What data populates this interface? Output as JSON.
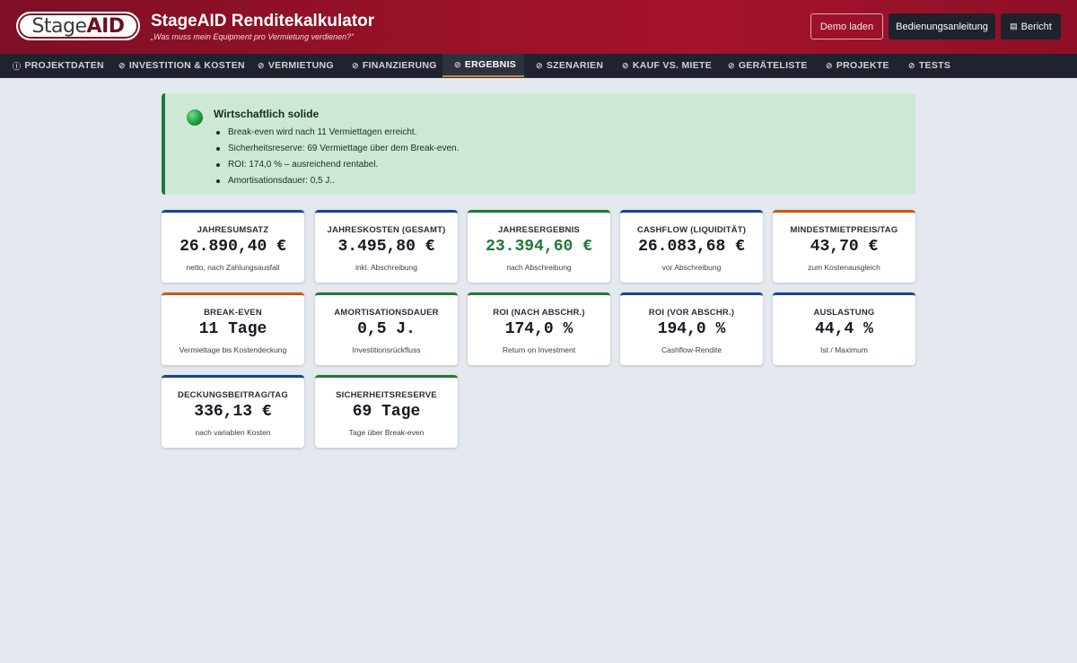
{
  "header": {
    "logo_stage": "Stage",
    "logo_aid": "AID",
    "title": "StageAID Renditekalkulator",
    "subtitle": "„Was muss mein Equipment pro Vermietung verdienen?“",
    "btn_demo": "Demo laden",
    "btn_manual": "Bedienungsanleitung",
    "btn_report": "Bericht"
  },
  "nav": [
    {
      "label": "PROJEKTDATEN",
      "icon": "info-icon"
    },
    {
      "label": "INVESTITION & KOSTEN",
      "icon": "circle-icon"
    },
    {
      "label": "VERMIETUNG",
      "icon": "circle-icon"
    },
    {
      "label": "FINANZIERUNG",
      "icon": "circle-icon"
    },
    {
      "label": "ERGEBNIS",
      "icon": "circle-icon"
    },
    {
      "label": "SZENARIEN",
      "icon": "circle-icon"
    },
    {
      "label": "KAUF VS. MIETE",
      "icon": "circle-icon"
    },
    {
      "label": "GERÄTELISTE",
      "icon": "circle-icon"
    },
    {
      "label": "PROJEKTE",
      "icon": "circle-icon"
    },
    {
      "label": "TESTS",
      "icon": "circle-icon"
    }
  ],
  "status": {
    "title": "Wirtschaftlich solide",
    "items": [
      "Break-even wird nach 11 Vermiettagen erreicht.",
      "Sicherheitsreserve: 69 Vermiettage über dem Break-even.",
      "ROI: 174,0 % – ausreichend rentabel.",
      "Amortisationsdauer: 0,5 J.."
    ],
    "color": "#1c7a3c"
  },
  "cards": [
    {
      "label": "JAHRESUMSATZ",
      "value": "26.890,40 €",
      "sub": "netto, nach Zahlungsausfall"
    },
    {
      "label": "JAHRESKOSTEN (GESAMT)",
      "value": "3.495,80 €",
      "sub": "inkl. Abschreibung"
    },
    {
      "label": "JAHRESERGEBNIS",
      "value": "23.394,60 €",
      "sub": "nach Abschreibung"
    },
    {
      "label": "CASHFLOW (LIQUIDITÄT)",
      "value": "26.083,68 €",
      "sub": "vor Abschreibung"
    },
    {
      "label": "MINDESTMIETPREIS/TAG",
      "value": "43,70 €",
      "sub": "zum Kostenausgleich"
    },
    {
      "label": "BREAK-EVEN",
      "value": "11 Tage",
      "sub": "Vermiettage bis Kostendeckung"
    },
    {
      "label": "AMORTISATIONSDAUER",
      "value": "0,5 J.",
      "sub": "Investitionsrückfluss"
    },
    {
      "label": "ROI (NACH ABSCHR.)",
      "value": "174,0 %",
      "sub": "Return on Investment"
    },
    {
      "label": "ROI (VOR ABSCHR.)",
      "value": "194,0 %",
      "sub": "Cashflow-Rendite"
    },
    {
      "label": "AUSLASTUNG",
      "value": "44,4 %",
      "sub": "Ist / Maximum"
    },
    {
      "label": "DECKUNGSBEITRAG/TAG",
      "value": "336,13 €",
      "sub": "nach variablen Kosten"
    },
    {
      "label": "SICHERHEITSRESERVE",
      "value": "69 Tage",
      "sub": "Tage über Break-even"
    }
  ],
  "colors": {
    "header_accent": "#9b1229",
    "positive": "#1d7a35",
    "card_blue": "#17458f",
    "card_green": "#1d7a35",
    "card_orange": "#c85a12"
  }
}
